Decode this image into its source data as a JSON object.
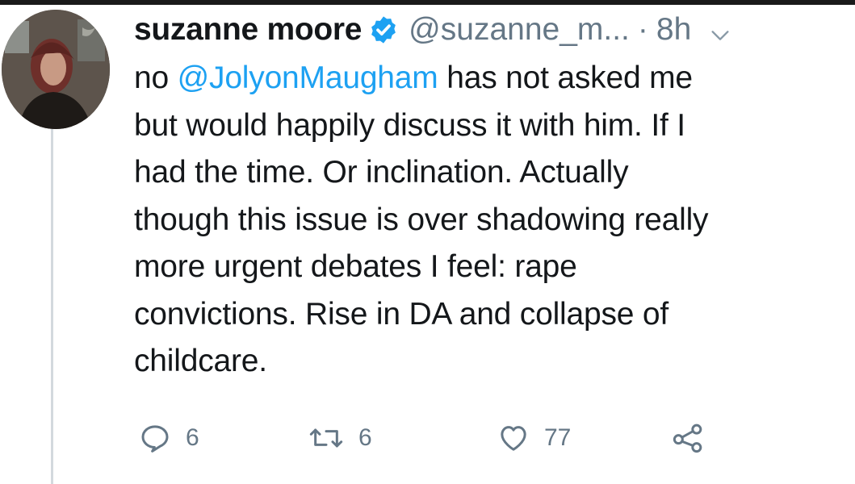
{
  "tweet": {
    "author_name": "suzanne moore",
    "author_handle": "@suzanne_m...",
    "separator": "·",
    "time": "8h",
    "text_parts": {
      "lead": "no ",
      "mention": "@JolyonMaugham",
      "line1_rest": " has not asked me",
      "line2": "but would happily discuss it with him. If I",
      "line3": "had the time.  Or inclination.  Actually",
      "line4": "though this issue is over shadowing really",
      "line5": "more urgent debates I feel: rape",
      "line6": "convictions. Rise in DA and collapse of",
      "line7": "childcare."
    },
    "reply_count": "6",
    "retweet_count": "6",
    "like_count": "77"
  },
  "icons": {
    "verified": "verified-badge-icon",
    "more": "chevron-down-icon",
    "reply": "reply-icon",
    "retweet": "retweet-icon",
    "like": "heart-icon",
    "share": "share-icon"
  },
  "colors": {
    "text": "#14171a",
    "secondary": "#657786",
    "link": "#1da1f2",
    "verified": "#1da1f2",
    "thread_line": "#d3d9de"
  }
}
